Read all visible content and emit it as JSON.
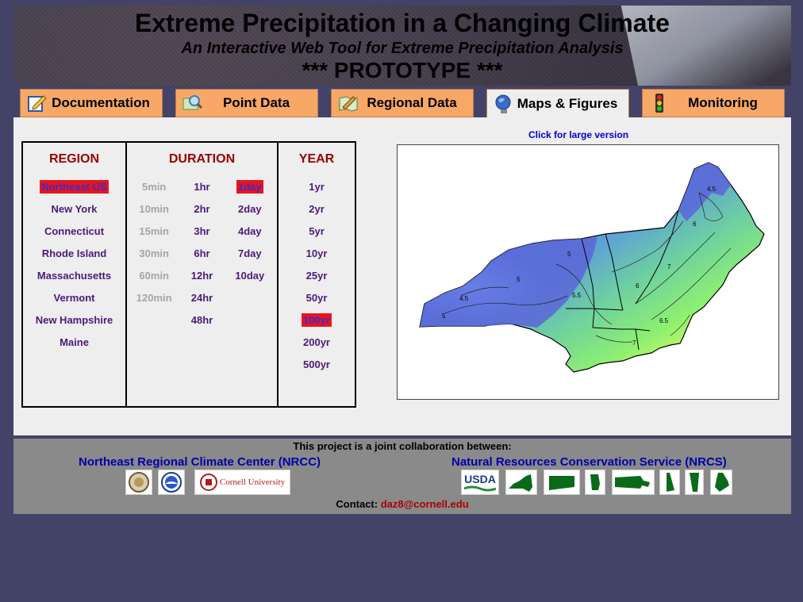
{
  "header": {
    "title": "Extreme Precipitation in a Changing Climate",
    "subtitle": "An Interactive Web Tool for Extreme Precipitation Analysis",
    "prototype": "*** PROTOTYPE ***"
  },
  "tabs": [
    {
      "label": "Documentation",
      "icon": "pencil-document-icon",
      "active": false
    },
    {
      "label": "Point Data",
      "icon": "magnifier-icon",
      "active": false
    },
    {
      "label": "Regional Data",
      "icon": "map-pencil-icon",
      "active": false
    },
    {
      "label": "Maps & Figures",
      "icon": "globe-icon",
      "active": true
    },
    {
      "label": "Monitoring",
      "icon": "traffic-light-icon",
      "active": false
    }
  ],
  "selector": {
    "region_header": "REGION",
    "duration_header": "DURATION",
    "year_header": "YEAR",
    "regions": [
      "Northeast US",
      "New York",
      "Connecticut",
      "Rhode Island",
      "Massachusetts",
      "Vermont",
      "New Hampshire",
      "Maine"
    ],
    "selected_region": "Northeast US",
    "durations_min": [
      "5min",
      "10min",
      "15min",
      "30min",
      "60min",
      "120min"
    ],
    "durations_hr": [
      "1hr",
      "2hr",
      "3hr",
      "6hr",
      "12hr",
      "24hr",
      "48hr"
    ],
    "durations_day": [
      "1day",
      "2day",
      "4day",
      "7day",
      "10day"
    ],
    "selected_duration": "1day",
    "years": [
      "1yr",
      "2yr",
      "5yr",
      "10yr",
      "25yr",
      "50yr",
      "100yr",
      "200yr",
      "500yr"
    ],
    "selected_year": "100yr"
  },
  "map": {
    "link_text": "Click for large version",
    "contour_labels": [
      "4.5",
      "5",
      "5.5",
      "6",
      "6.5",
      "7",
      "4.5",
      "5",
      "5",
      "6",
      "7"
    ]
  },
  "footer": {
    "collab": "This project is a joint collaboration between:",
    "nrcc": "Northeast Regional Climate Center (NRCC)",
    "nrcs": "Natural Resources Conservation Service (NRCS)",
    "logos_left": [
      "ncdc-seal",
      "noaa-seal",
      "Cornell University"
    ],
    "usda_label": "USDA",
    "state_logos": [
      "new-york-state",
      "connecticut-state",
      "rhode-island-state",
      "massachusetts-state",
      "new-hampshire-state",
      "vermont-state",
      "maine-state"
    ],
    "contact_label": "Contact:",
    "contact_email": "daz8@cornell.edu"
  }
}
